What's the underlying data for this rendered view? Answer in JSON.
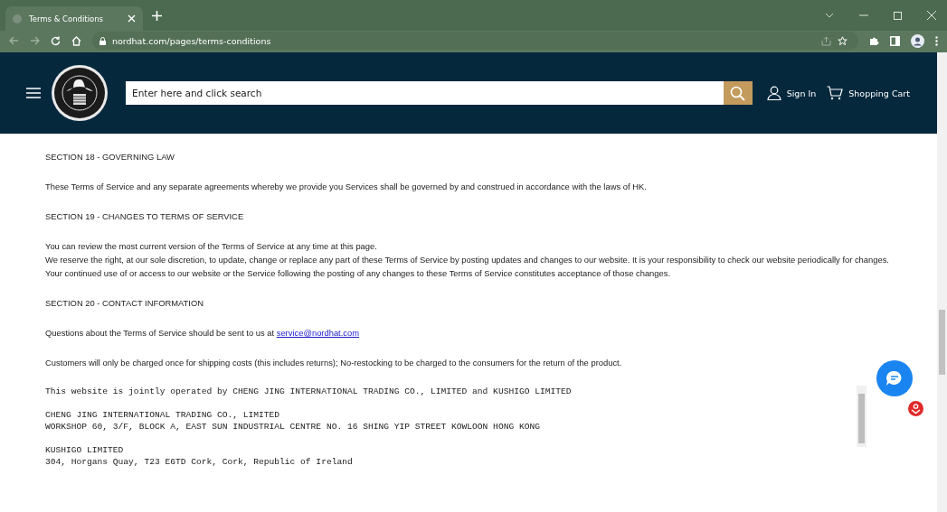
{
  "browser": {
    "tab_title": "Terms & Conditions",
    "url": "nordhat.com/pages/terms-conditions"
  },
  "header": {
    "search_placeholder": "Enter here and click search",
    "sign_in": "Sign In",
    "cart": "Shopping Cart"
  },
  "content": [
    {
      "kind": "heading",
      "lines": [
        "SECTION 18 - GOVERNING LAW"
      ]
    },
    {
      "kind": "text",
      "lines": [
        "These Terms of Service and any separate agreements whereby we provide you Services shall be governed by and construed in accordance with the laws of HK."
      ]
    },
    {
      "kind": "heading",
      "lines": [
        "SECTION 19 - CHANGES TO TERMS OF SERVICE"
      ]
    },
    {
      "kind": "text",
      "lines": [
        "You can review the most current version of the Terms of Service at any time at this page.",
        "We reserve the right, at our sole discretion, to update, change or replace any part of these Terms of Service by posting updates and changes to our website. It is your responsibility to check our website periodically for changes. Your continued use of or access to our website or the Service following the posting of any changes to these Terms of Service constitutes acceptance of those changes."
      ]
    },
    {
      "kind": "heading",
      "lines": [
        "SECTION 20 - CONTACT INFORMATION"
      ]
    },
    {
      "kind": "link",
      "lines": [
        "Questions about the Terms of Service should be sent to us at "
      ],
      "link": "service@nordhat.com"
    },
    {
      "kind": "text",
      "lines": [
        "Customers will only be charged once for shipping costs (this includes returns); No-restocking to be charged to the consumers for the return of the product."
      ]
    }
  ],
  "notice": [
    [
      "This website is jointly operated by CHENG JING INTERNATIONAL TRADING CO., LIMITED and KUSHIGO LIMITED"
    ],
    [
      "CHENG JING INTERNATIONAL TRADING CO., LIMITED",
      "WORKSHOP 60, 3/F, BLOCK A, EAST SUN INDUSTRIAL CENTRE NO. 16 SHING YIP STREET KOWLOON HONG KONG"
    ],
    [
      "KUSHIGO LIMITED",
      "304, Horgans Quay, T23 E6TD Cork, Cork, Republic of Ireland"
    ]
  ]
}
